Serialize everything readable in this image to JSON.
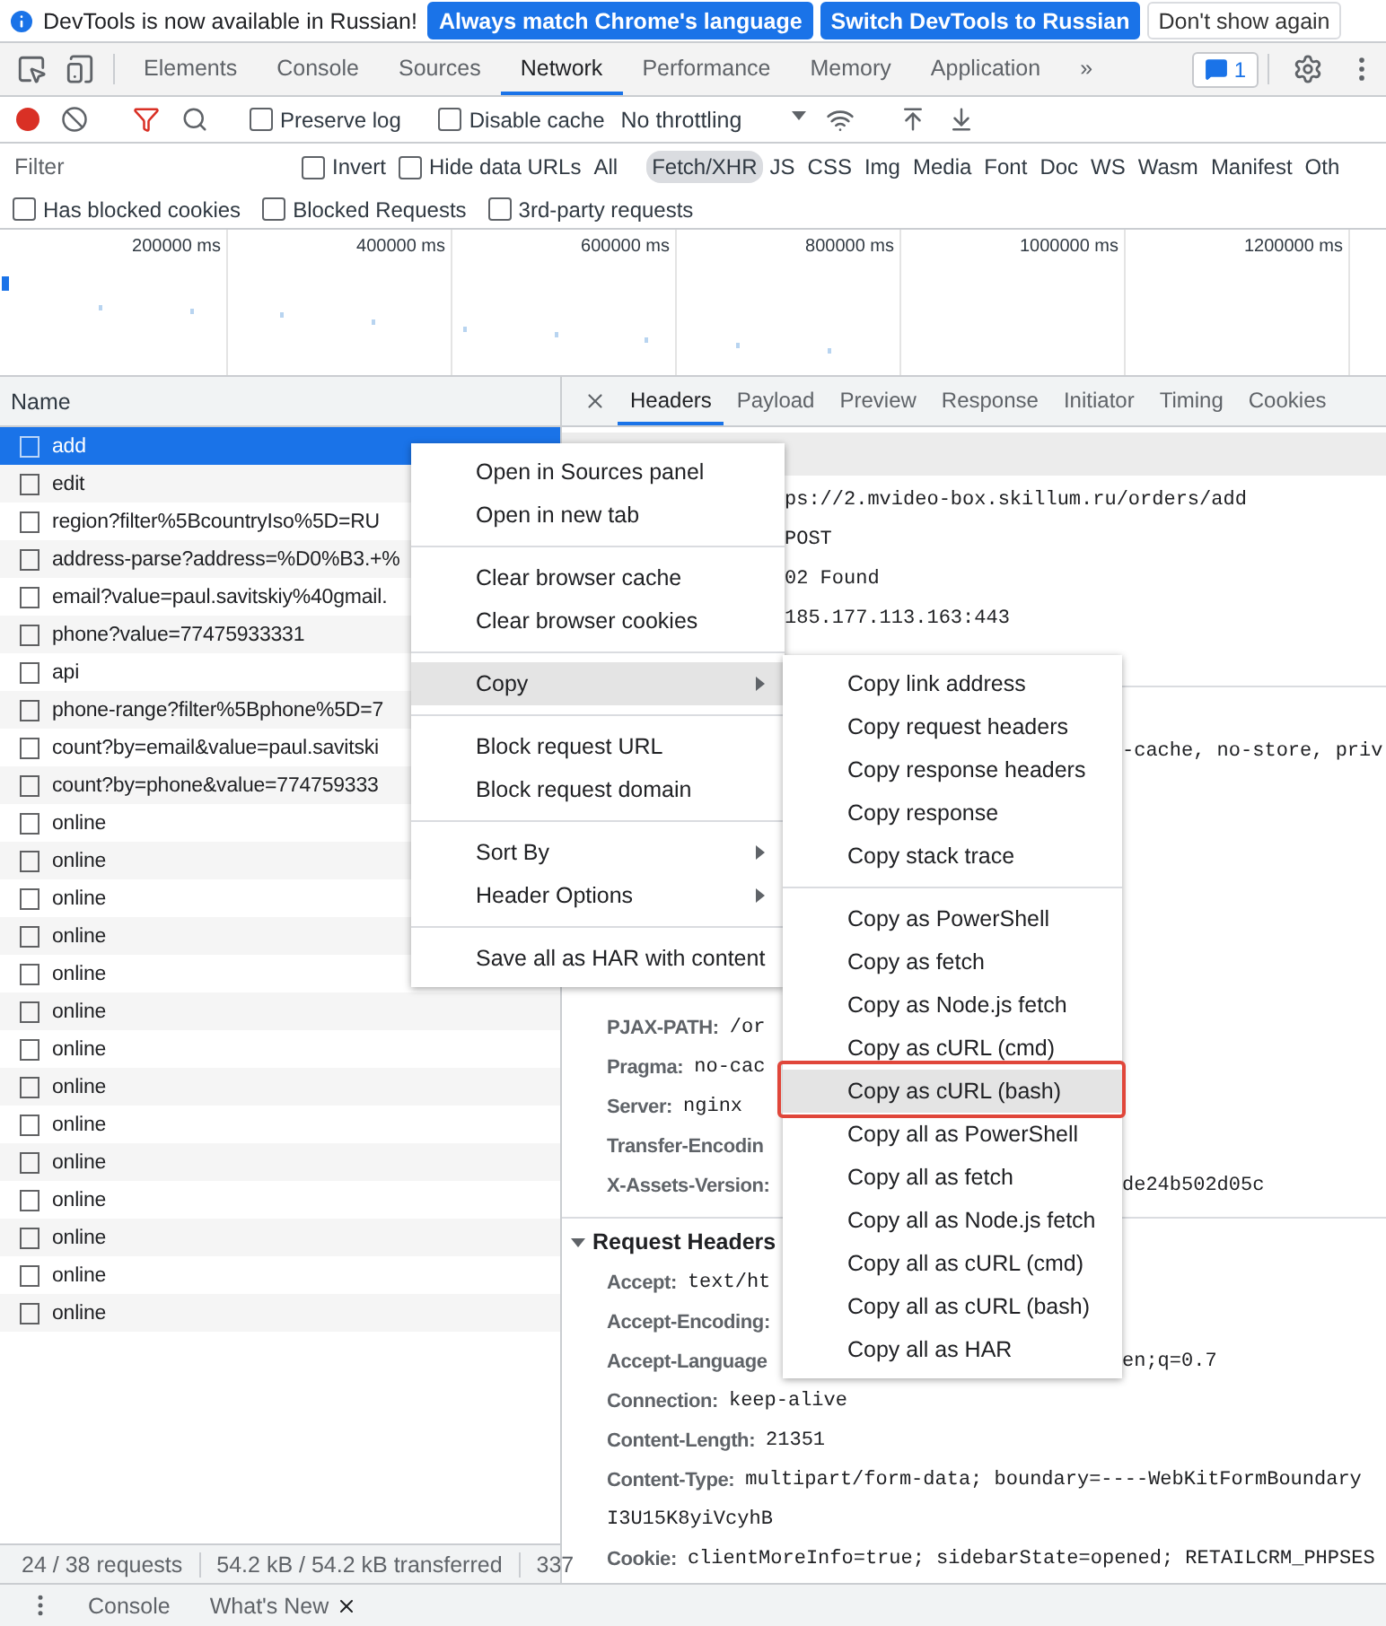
{
  "infobar": {
    "message": "DevTools is now available in Russian!",
    "buttons": [
      {
        "label": "Always match Chrome's language",
        "kind": "primary"
      },
      {
        "label": "Switch DevTools to Russian",
        "kind": "primary"
      },
      {
        "label": "Don't show again",
        "kind": "secondary"
      }
    ]
  },
  "panel_tabs": [
    {
      "label": "Elements",
      "selected": false
    },
    {
      "label": "Console",
      "selected": false
    },
    {
      "label": "Sources",
      "selected": false
    },
    {
      "label": "Network",
      "selected": true
    },
    {
      "label": "Performance",
      "selected": false
    },
    {
      "label": "Memory",
      "selected": false
    },
    {
      "label": "Application",
      "selected": false
    }
  ],
  "more_tabs": "»",
  "issues_badge": "1",
  "toolbar": {
    "recording": true,
    "preserve_log": {
      "label": "Preserve log",
      "checked": false
    },
    "disable_cache": {
      "label": "Disable cache",
      "checked": false
    },
    "throttling": "No throttling"
  },
  "filter_bar": {
    "placeholder": "Filter",
    "invert": {
      "label": "Invert",
      "checked": false
    },
    "hide_data_urls": {
      "label": "Hide data URLs",
      "checked": false
    },
    "types": [
      {
        "label": "All",
        "selected": false
      },
      {
        "label": "Fetch/XHR",
        "selected": true
      },
      {
        "label": "JS",
        "selected": false
      },
      {
        "label": "CSS",
        "selected": false
      },
      {
        "label": "Img",
        "selected": false
      },
      {
        "label": "Media",
        "selected": false
      },
      {
        "label": "Font",
        "selected": false
      },
      {
        "label": "Doc",
        "selected": false
      },
      {
        "label": "WS",
        "selected": false
      },
      {
        "label": "Wasm",
        "selected": false
      },
      {
        "label": "Manifest",
        "selected": false
      },
      {
        "label": "Oth",
        "selected": false
      }
    ]
  },
  "extra_filters": [
    {
      "label": "Has blocked cookies",
      "checked": false
    },
    {
      "label": "Blocked Requests",
      "checked": false
    },
    {
      "label": "3rd-party requests",
      "checked": false
    }
  ],
  "overview": {
    "ticks": [
      "200000 ms",
      "400000 ms",
      "600000 ms",
      "800000 ms",
      "1000000 ms",
      "1200000 ms"
    ]
  },
  "requests": {
    "column": "Name",
    "rows": [
      {
        "name": "add",
        "selected": true
      },
      {
        "name": "edit",
        "selected": false
      },
      {
        "name": "region?filter%5BcountryIso%5D=RU",
        "selected": false
      },
      {
        "name": "address-parse?address=%D0%B3.+%",
        "selected": false
      },
      {
        "name": "email?value=paul.savitskiy%40gmail.",
        "selected": false
      },
      {
        "name": "phone?value=77475933331",
        "selected": false
      },
      {
        "name": "api",
        "selected": false
      },
      {
        "name": "phone-range?filter%5Bphone%5D=7",
        "selected": false
      },
      {
        "name": "count?by=email&value=paul.savitski",
        "selected": false
      },
      {
        "name": "count?by=phone&value=774759333",
        "selected": false
      },
      {
        "name": "online",
        "selected": false
      },
      {
        "name": "online",
        "selected": false
      },
      {
        "name": "online",
        "selected": false
      },
      {
        "name": "online",
        "selected": false
      },
      {
        "name": "online",
        "selected": false
      },
      {
        "name": "online",
        "selected": false
      },
      {
        "name": "online",
        "selected": false
      },
      {
        "name": "online",
        "selected": false
      },
      {
        "name": "online",
        "selected": false
      },
      {
        "name": "online",
        "selected": false
      },
      {
        "name": "online",
        "selected": false
      },
      {
        "name": "online",
        "selected": false
      },
      {
        "name": "online",
        "selected": false
      },
      {
        "name": "online",
        "selected": false
      }
    ]
  },
  "details": {
    "tabs": [
      {
        "label": "Headers",
        "selected": true
      },
      {
        "label": "Payload",
        "selected": false
      },
      {
        "label": "Preview",
        "selected": false
      },
      {
        "label": "Response",
        "selected": false
      },
      {
        "label": "Initiator",
        "selected": false
      },
      {
        "label": "Timing",
        "selected": false
      },
      {
        "label": "Cookies",
        "selected": false
      }
    ],
    "general_fragments": [
      "ps://2.mvideo-box.skillum.ru/orders/add",
      "POST",
      "02 Found",
      "185.177.113.163:443"
    ],
    "response_rows": [
      {
        "kind": "tail",
        "tail": "-cache, no-store, priv"
      },
      {
        "kind": "header",
        "name": "PJAX-PATH:",
        "value": "/or"
      },
      {
        "kind": "header",
        "name": "Pragma:",
        "value": "no-cac"
      },
      {
        "kind": "header",
        "name": "Server:",
        "value": "nginx"
      },
      {
        "kind": "header",
        "name": "Transfer-Encodin"
      },
      {
        "kind": "header",
        "name": "X-Assets-Version:",
        "tail": "de24b502d05c"
      }
    ],
    "request_section": {
      "title": "Request Headers",
      "expanded": true,
      "rows": [
        {
          "kind": "header",
          "name": "Accept:",
          "value": "text/ht"
        },
        {
          "kind": "header",
          "name": "Accept-Encoding:"
        },
        {
          "kind": "header",
          "name": "Accept-Language",
          "tail": "en;q=0.7"
        },
        {
          "kind": "header",
          "name": "Connection:",
          "value": "keep-alive"
        },
        {
          "kind": "header",
          "name": "Content-Length:",
          "value": "21351"
        },
        {
          "kind": "header",
          "name": "Content-Type:",
          "value": "multipart/form-data; boundary=----WebKitFormBoundary"
        },
        {
          "kind": "continuation",
          "value": "I3U15K8yiVcyhB"
        },
        {
          "kind": "header",
          "name": "Cookie:",
          "value": "clientMoreInfo=true; sidebarState=opened; RETAILCRM_PHPSES"
        }
      ]
    }
  },
  "status_bar": [
    "24 / 38 requests",
    "54.2 kB / 54.2 kB transferred",
    "337"
  ],
  "drawer": {
    "tabs": [
      {
        "label": "Console",
        "closable": false
      },
      {
        "label": "What's New",
        "closable": true
      }
    ]
  },
  "context_menu": {
    "groups": [
      [
        {
          "label": "Open in Sources panel",
          "highlighted": false,
          "has_submenu": false
        },
        {
          "label": "Open in new tab",
          "highlighted": false,
          "has_submenu": false
        }
      ],
      [
        {
          "label": "Clear browser cache",
          "highlighted": false,
          "has_submenu": false
        },
        {
          "label": "Clear browser cookies",
          "highlighted": false,
          "has_submenu": false
        }
      ],
      [
        {
          "label": "Copy",
          "highlighted": true,
          "has_submenu": true
        }
      ],
      [
        {
          "label": "Block request URL",
          "highlighted": false,
          "has_submenu": false
        },
        {
          "label": "Block request domain",
          "highlighted": false,
          "has_submenu": false
        }
      ],
      [
        {
          "label": "Sort By",
          "highlighted": false,
          "has_submenu": true
        },
        {
          "label": "Header Options",
          "highlighted": false,
          "has_submenu": true
        }
      ],
      [
        {
          "label": "Save all as HAR with content",
          "highlighted": false,
          "has_submenu": false
        }
      ]
    ]
  },
  "copy_submenu": {
    "groups": [
      [
        {
          "label": "Copy link address",
          "highlighted": false,
          "annotated": false
        },
        {
          "label": "Copy request headers",
          "highlighted": false,
          "annotated": false
        },
        {
          "label": "Copy response headers",
          "highlighted": false,
          "annotated": false
        },
        {
          "label": "Copy response",
          "highlighted": false,
          "annotated": false
        },
        {
          "label": "Copy stack trace",
          "highlighted": false,
          "annotated": false
        }
      ],
      [
        {
          "label": "Copy as PowerShell",
          "highlighted": false,
          "annotated": false
        },
        {
          "label": "Copy as fetch",
          "highlighted": false,
          "annotated": false
        },
        {
          "label": "Copy as Node.js fetch",
          "highlighted": false,
          "annotated": false
        },
        {
          "label": "Copy as cURL (cmd)",
          "highlighted": false,
          "annotated": false
        },
        {
          "label": "Copy as cURL (bash)",
          "highlighted": true,
          "annotated": true
        },
        {
          "label": "Copy all as PowerShell",
          "highlighted": false,
          "annotated": false
        },
        {
          "label": "Copy all as fetch",
          "highlighted": false,
          "annotated": false
        },
        {
          "label": "Copy all as Node.js fetch",
          "highlighted": false,
          "annotated": false
        },
        {
          "label": "Copy all as cURL (cmd)",
          "highlighted": false,
          "annotated": false
        },
        {
          "label": "Copy all as cURL (bash)",
          "highlighted": false,
          "annotated": false
        },
        {
          "label": "Copy all as HAR",
          "highlighted": false,
          "annotated": false
        }
      ]
    ]
  }
}
